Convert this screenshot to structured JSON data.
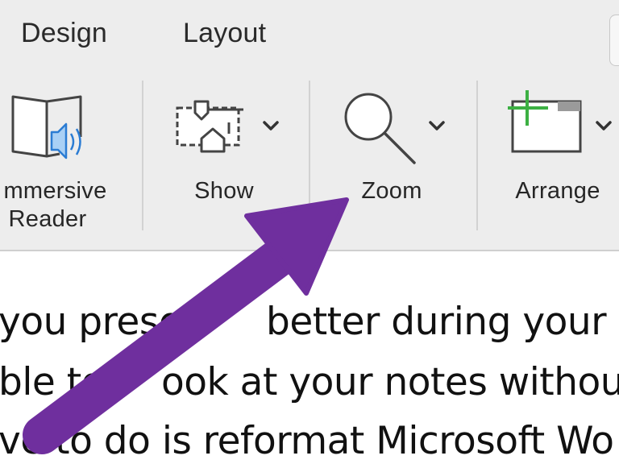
{
  "tabs": {
    "design": "Design",
    "layout": "Layout"
  },
  "ribbon": {
    "immersive_reader": {
      "line1": "mmersive",
      "line2": "Reader",
      "icon": "immersive-reader-icon"
    },
    "show": {
      "label": "Show",
      "icon": "show-icon"
    },
    "zoom": {
      "label": "Zoom",
      "icon": "magnifier-icon"
    },
    "arrange": {
      "label": "Arrange",
      "icon": "arrange-icon"
    }
  },
  "document": {
    "lines": [
      "you prese",
      "better during your ne",
      "ble to",
      "ook at your notes without",
      "ve to do is reformat Microsoft Wo"
    ]
  },
  "annotation": {
    "arrow_color": "#6f2f9e",
    "accent_green": "#3cb043",
    "speaker_blue": "#2b7cd3"
  }
}
